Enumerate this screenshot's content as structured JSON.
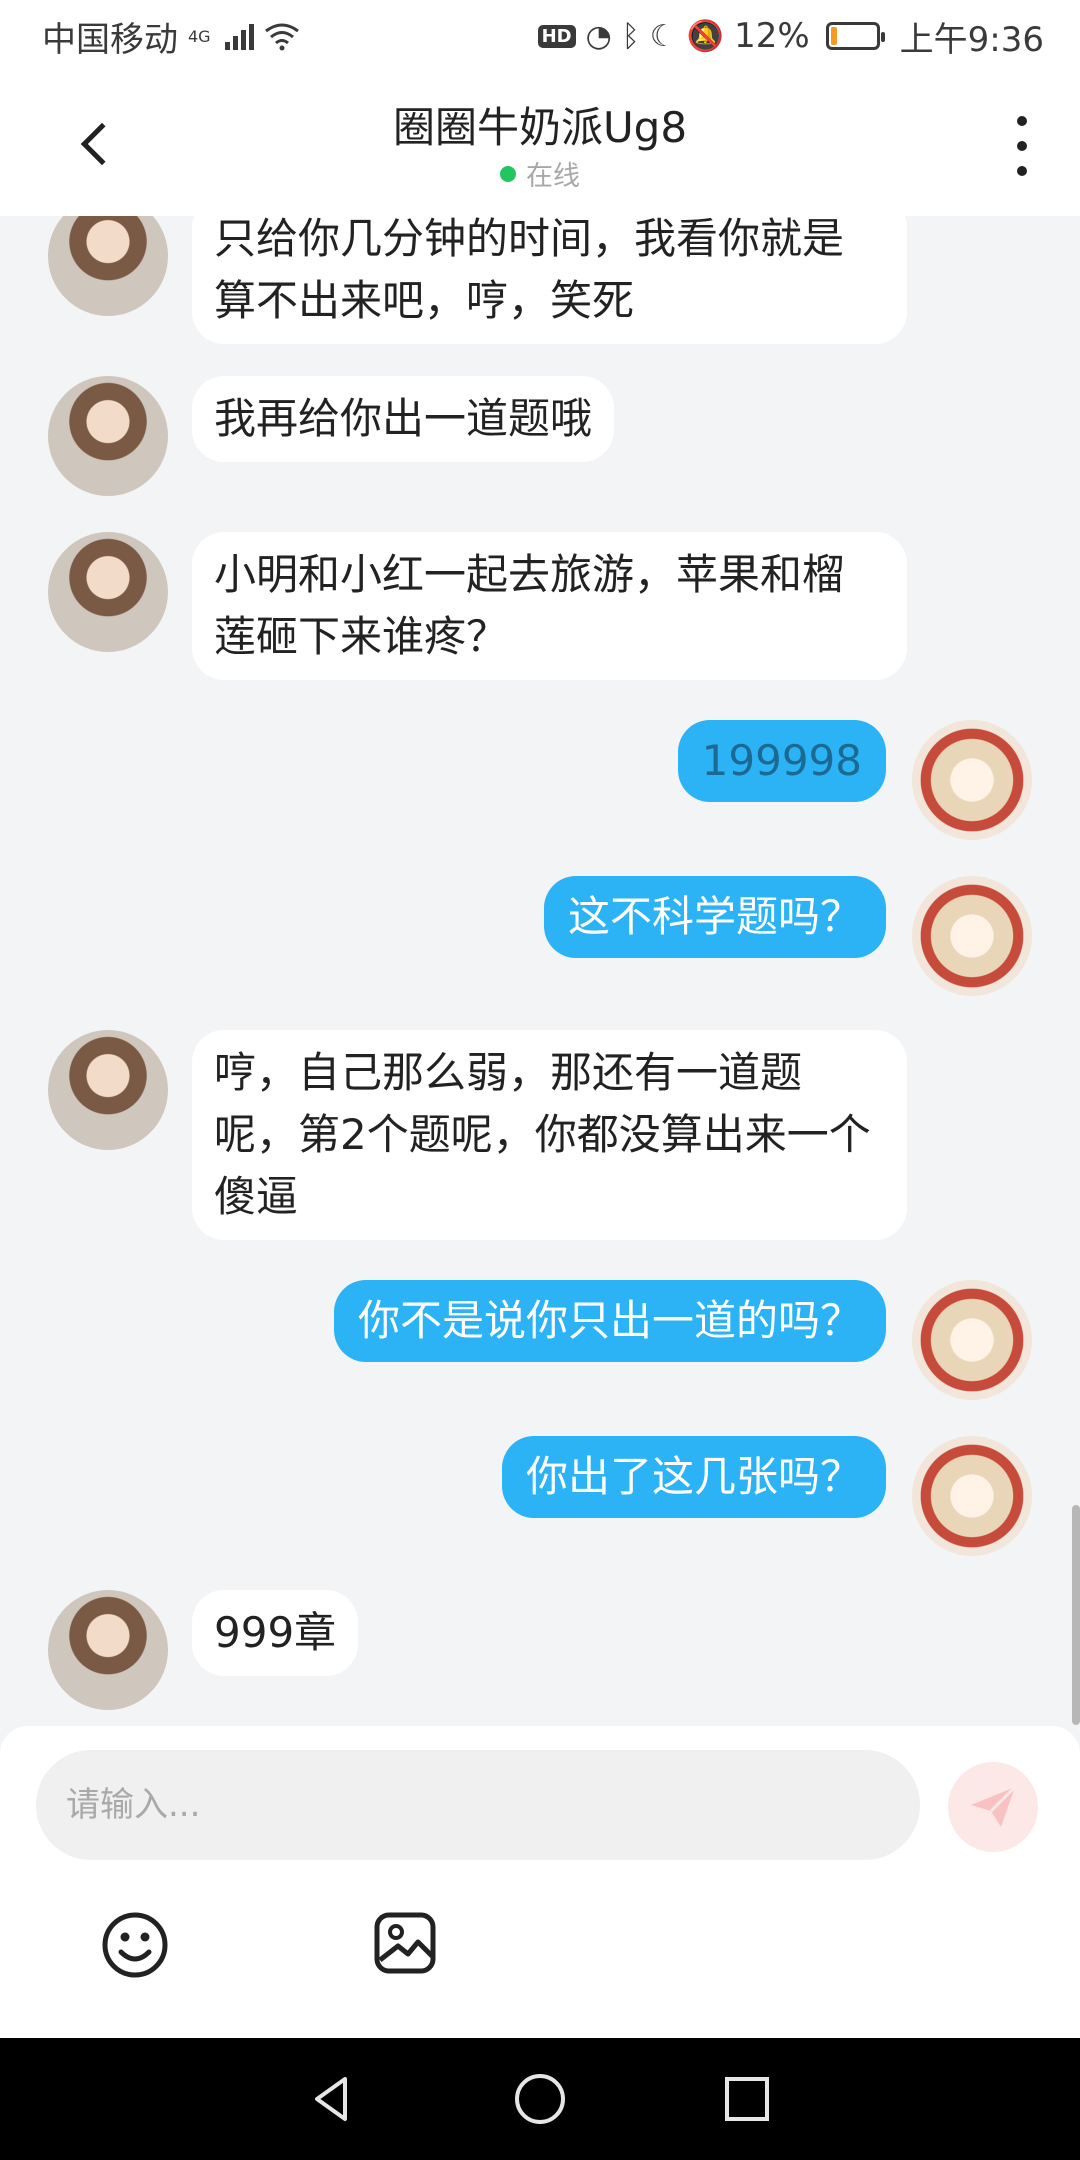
{
  "status_bar": {
    "carrier": "中国移动",
    "network": "4G",
    "hd_label": "HD",
    "battery_percent": "12%",
    "battery_level": 0.12,
    "time": "上午9:36"
  },
  "header": {
    "title": "圈圈牛奶派Ug8",
    "status": "在线"
  },
  "messages": [
    {
      "side": "left",
      "text": "只给你几分钟的时间，我看你就是算不出来吧，哼，笑死"
    },
    {
      "side": "left",
      "text": "我再给你出一道题哦"
    },
    {
      "side": "left",
      "text": "小明和小红一起去旅游，苹果和榴莲砸下来谁疼？"
    },
    {
      "side": "right",
      "text": "199998"
    },
    {
      "side": "right",
      "text": "这不科学题吗？"
    },
    {
      "side": "left",
      "text": "哼，自己那么弱，那还有一道题呢，第2个题呢，你都没算出来一个傻逼"
    },
    {
      "side": "right",
      "text": "你不是说你只出一道的吗？"
    },
    {
      "side": "right",
      "text": "你出了这几张吗？"
    },
    {
      "side": "left",
      "text": "999章"
    }
  ],
  "composer": {
    "placeholder": "请输入..."
  },
  "colors": {
    "accent_blue": "#2bb3f5",
    "online_green": "#22c55e",
    "send_disabled": "#fde8e8"
  },
  "icons": {
    "back": "chevron-left-icon",
    "more": "more-vertical-icon",
    "send": "paper-plane-icon",
    "emoji": "smiley-icon",
    "image": "image-icon",
    "nav_back": "triangle-back-icon",
    "nav_home": "circle-home-icon",
    "nav_recents": "square-recents-icon"
  }
}
